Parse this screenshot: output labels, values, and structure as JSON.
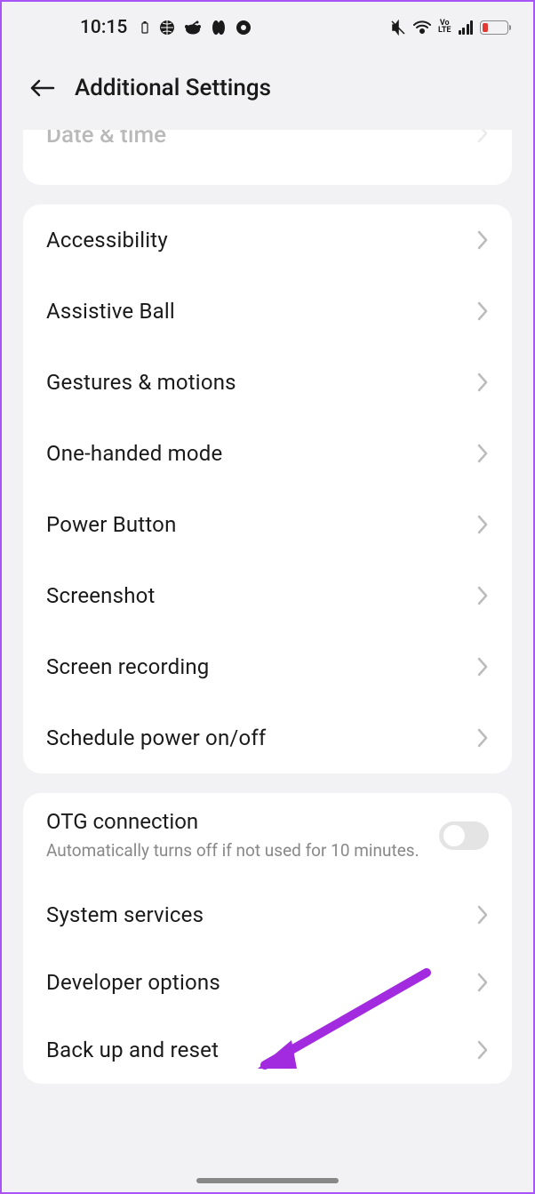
{
  "statusbar": {
    "time": "10:15"
  },
  "header": {
    "title": "Additional Settings"
  },
  "partial": {
    "label": "Date & time"
  },
  "group1": {
    "items": [
      {
        "label": "Accessibility"
      },
      {
        "label": "Assistive Ball"
      },
      {
        "label": "Gestures & motions"
      },
      {
        "label": "One-handed mode"
      },
      {
        "label": "Power Button"
      },
      {
        "label": "Screenshot"
      },
      {
        "label": "Screen recording"
      },
      {
        "label": "Schedule power on/off"
      }
    ]
  },
  "group2": {
    "otg": {
      "label": "OTG connection",
      "desc": "Automatically turns off if not used for 10 minutes."
    },
    "items": [
      {
        "label": "System services"
      },
      {
        "label": "Developer options"
      },
      {
        "label": "Back up and reset"
      }
    ]
  }
}
